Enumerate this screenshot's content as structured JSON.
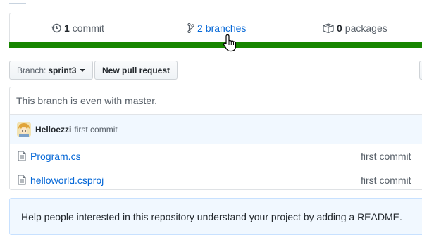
{
  "summary": {
    "commits": {
      "count": "1",
      "label": "commit",
      "icon": "history-icon"
    },
    "branches": {
      "count": "2",
      "label": "branches",
      "icon": "git-branch-icon"
    },
    "packages": {
      "count": "0",
      "label": "packages",
      "icon": "package-icon"
    }
  },
  "language_bar": {
    "color": "#178600"
  },
  "toolbar": {
    "branch_prefix": "Branch:",
    "branch_name": "sprint3",
    "new_pr_label": "New pull request"
  },
  "branch_status": "This branch is even with master.",
  "latest_commit": {
    "author": "Helloezzi",
    "message": "first commit"
  },
  "files": [
    {
      "name": "Program.cs",
      "commit_message": "first commit"
    },
    {
      "name": "helloworld.csproj",
      "commit_message": "first commit"
    }
  ],
  "readme_prompt": "Help people interested in this repository understand your project by adding a README.",
  "colors": {
    "link": "#0366d6",
    "accent_bg": "#f1f8ff",
    "language_csharp": "#178600"
  }
}
